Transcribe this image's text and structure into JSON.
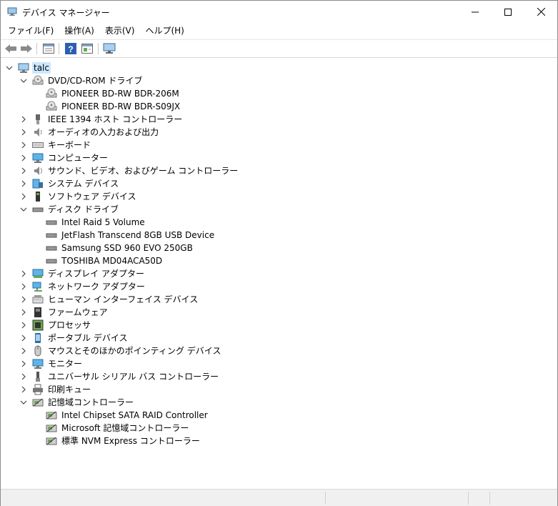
{
  "window": {
    "title": "デバイス マネージャー",
    "controls": {
      "minimize": "─",
      "maximize": "☐",
      "close": "✕"
    }
  },
  "menu": [
    "ファイル(F)",
    "操作(A)",
    "表示(V)",
    "ヘルプ(H)"
  ],
  "toolbar": [
    "back-icon",
    "forward-icon",
    "properties-icon",
    "help-icon",
    "update-driver-icon",
    "monitor-icon"
  ],
  "tree": {
    "root": "talc",
    "categories": [
      {
        "label": "DVD/CD-ROM ドライブ",
        "icon": "dvd-drive-icon",
        "expanded": true,
        "children": [
          "PIONEER BD-RW   BDR-206M",
          "PIONEER BD-RW   BDR-S09JX"
        ]
      },
      {
        "label": "IEEE 1394 ホスト コントローラー",
        "icon": "firewire-icon",
        "expanded": false
      },
      {
        "label": "オーディオの入力および出力",
        "icon": "speaker-icon",
        "expanded": false
      },
      {
        "label": "キーボード",
        "icon": "keyboard-icon",
        "expanded": false
      },
      {
        "label": "コンピューター",
        "icon": "computer-icon",
        "expanded": false
      },
      {
        "label": "サウンド、ビデオ、およびゲーム コントローラー",
        "icon": "sound-icon",
        "expanded": false
      },
      {
        "label": "システム デバイス",
        "icon": "system-device-icon",
        "expanded": false
      },
      {
        "label": "ソフトウェア デバイス",
        "icon": "software-device-icon",
        "expanded": false
      },
      {
        "label": "ディスク ドライブ",
        "icon": "disk-drive-icon",
        "expanded": true,
        "children": [
          "Intel Raid 5 Volume",
          "JetFlash Transcend 8GB USB Device",
          "Samsung SSD 960 EVO 250GB",
          "TOSHIBA MD04ACA50D"
        ]
      },
      {
        "label": "ディスプレイ アダプター",
        "icon": "display-adapter-icon",
        "expanded": false
      },
      {
        "label": "ネットワーク アダプター",
        "icon": "network-adapter-icon",
        "expanded": false
      },
      {
        "label": "ヒューマン インターフェイス デバイス",
        "icon": "hid-icon",
        "expanded": false
      },
      {
        "label": "ファームウェア",
        "icon": "firmware-icon",
        "expanded": false
      },
      {
        "label": "プロセッサ",
        "icon": "processor-icon",
        "expanded": false
      },
      {
        "label": "ポータブル デバイス",
        "icon": "portable-device-icon",
        "expanded": false
      },
      {
        "label": "マウスとそのほかのポインティング デバイス",
        "icon": "mouse-icon",
        "expanded": false
      },
      {
        "label": "モニター",
        "icon": "monitor-icon",
        "expanded": false
      },
      {
        "label": "ユニバーサル シリアル バス コントローラー",
        "icon": "usb-icon",
        "expanded": false
      },
      {
        "label": "印刷キュー",
        "icon": "printer-icon",
        "expanded": false
      },
      {
        "label": "記憶域コントローラー",
        "icon": "storage-controller-icon",
        "expanded": true,
        "children": [
          "Intel Chipset SATA RAID Controller",
          "Microsoft 記憶域コントローラー",
          "標準 NVM Express コントローラー"
        ]
      }
    ]
  },
  "colors": {
    "selection": "#cce8ff",
    "statusbar": "#f0f0f0"
  }
}
